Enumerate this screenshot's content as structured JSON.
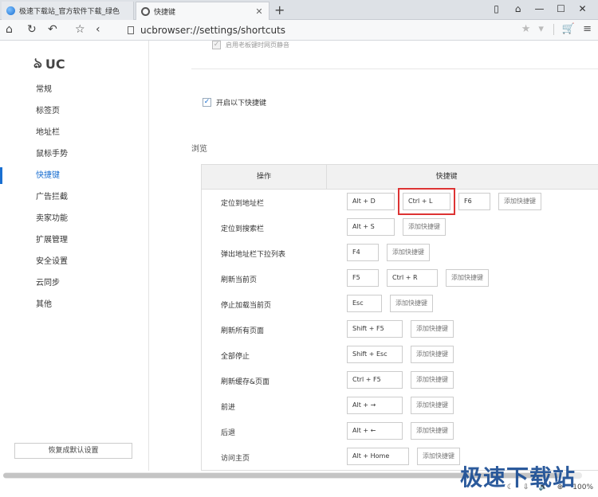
{
  "tabs": [
    {
      "title": "极速下载站_官方软件下载_绿色",
      "active": false
    },
    {
      "title": "快捷键",
      "active": true
    }
  ],
  "window_buttons": [
    "▯",
    "⌂",
    "—",
    "☐",
    "✕"
  ],
  "address": {
    "url": "ucbrowser://settings/shortcuts"
  },
  "logo": {
    "text": "UC"
  },
  "sidebar": {
    "items": [
      {
        "label": "常规"
      },
      {
        "label": "标签页"
      },
      {
        "label": "地址栏"
      },
      {
        "label": "鼠标手势"
      },
      {
        "label": "快捷键",
        "active": true
      },
      {
        "label": "广告拦截"
      },
      {
        "label": "卖家功能"
      },
      {
        "label": "扩展管理"
      },
      {
        "label": "安全设置"
      },
      {
        "label": "云同步"
      },
      {
        "label": "其他"
      }
    ],
    "restore_button": "恢复成默认设置"
  },
  "main": {
    "boss_key_option": "启用老板键时网页静音",
    "enable_option": "开启以下快捷键",
    "section_title": "浏览",
    "table": {
      "col_action": "操作",
      "col_shortcut": "快捷键",
      "rows": [
        {
          "action": "定位到地址栏",
          "keys": [
            "Alt + D",
            "Ctrl + L",
            "F6"
          ],
          "add": "添加快捷键"
        },
        {
          "action": "定位到搜索栏",
          "keys": [
            "Alt + S"
          ],
          "add": "添加快捷键"
        },
        {
          "action": "弹出地址栏下拉列表",
          "keys": [
            "F4"
          ],
          "add": "添加快捷键"
        },
        {
          "action": "刷新当前页",
          "keys": [
            "F5",
            "Ctrl + R"
          ],
          "add": "添加快捷键"
        },
        {
          "action": "停止加载当前页",
          "keys": [
            "Esc"
          ],
          "add": "添加快捷键"
        },
        {
          "action": "刷新所有页面",
          "keys": [
            "Shift + F5"
          ],
          "add": "添加快捷键"
        },
        {
          "action": "全部停止",
          "keys": [
            "Shift + Esc"
          ],
          "add": "添加快捷键"
        },
        {
          "action": "刷新缓存&页面",
          "keys": [
            "Ctrl + F5"
          ],
          "add": "添加快捷键"
        },
        {
          "action": "前进",
          "keys": [
            "Alt + →"
          ],
          "add": "添加快捷键"
        },
        {
          "action": "后退",
          "keys": [
            "Alt + ←"
          ],
          "add": "添加快捷键"
        },
        {
          "action": "访问主页",
          "keys": [
            "Alt + Home"
          ],
          "add": "添加快捷键"
        }
      ]
    }
  },
  "status": {
    "zoom": "100%"
  },
  "watermark": "极速下载站"
}
